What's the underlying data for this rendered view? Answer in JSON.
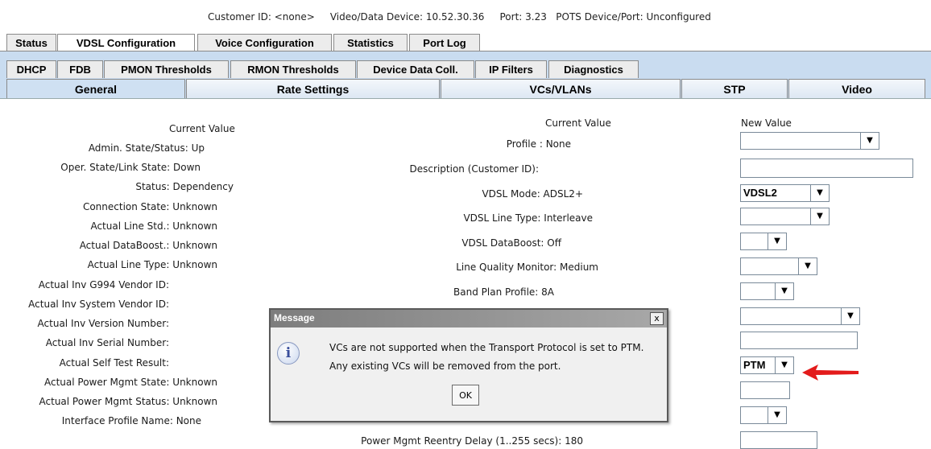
{
  "header": {
    "info_line": "Customer ID: <none>     Video/Data Device: 10.52.30.36     Port: 3.23   POTS Device/Port: Unconfigured"
  },
  "tabs_row1": [
    "Status",
    "VDSL Configuration",
    "Voice Configuration",
    "Statistics",
    "Port Log"
  ],
  "tabs_row2": [
    "DHCP",
    "FDB",
    "PMON Thresholds",
    "RMON Thresholds",
    "Device Data Coll.",
    "IP Filters",
    "Diagnostics"
  ],
  "tabs_row3": [
    "General",
    "Rate Settings",
    "VCs/VLANs",
    "STP",
    "Video"
  ],
  "left_panel": {
    "header": "Current Value",
    "rows": [
      "Admin. State/Status: Up",
      "Oper. State/Link State: Down",
      "Status: Dependency",
      "Connection State: Unknown",
      "Actual Line Std.: Unknown",
      "Actual DataBoost.: Unknown",
      "Actual Line Type: Unknown",
      "Actual Inv G994 Vendor ID:",
      "Actual Inv System Vendor ID:",
      "Actual Inv Version Number:",
      "Actual Inv Serial Number:",
      "Actual Self Test Result:",
      "Actual Power Mgmt State: Unknown",
      "Actual Power Mgmt Status: Unknown",
      "Interface Profile Name: None"
    ]
  },
  "mid_panel": {
    "header": "Current Value",
    "rows": [
      "Profile : None",
      "Description (Customer ID):",
      "VDSL Mode: ADSL2+",
      "VDSL Line Type: Interleave",
      "VDSL DataBoost: Off",
      "Line Quality Monitor: Medium",
      "Band Plan Profile: 8A",
      "Power Mgmt Reentry Delay (1..255 secs): 180"
    ]
  },
  "right_panel": {
    "header": "New Value",
    "vdsl_mode_value": "VDSL2",
    "transport_value": "PTM",
    "dropdown_arrow": "▼"
  },
  "dialog": {
    "title": "Message",
    "close": "x",
    "icon": "i",
    "line1": "VCs are not supported when the Transport Protocol is set to PTM.",
    "line2": "Any existing VCs will be removed from the port.",
    "ok": "OK"
  },
  "colors": {
    "tab_area": "#c9dcf0",
    "annotation_arrow": "#e31b1b"
  }
}
